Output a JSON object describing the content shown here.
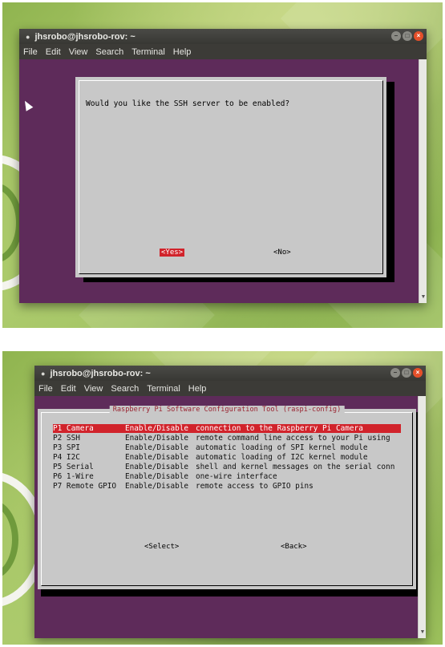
{
  "top": {
    "window_title": "jhsrobo@jhsrobo-rov: ~",
    "menu": [
      "File",
      "Edit",
      "View",
      "Search",
      "Terminal",
      "Help"
    ],
    "dialog": {
      "question": "Would you like the SSH server to be enabled?",
      "yes_label": "<Yes>",
      "no_label": "<No>",
      "selected": "yes"
    }
  },
  "bottom": {
    "window_title": "jhsrobo@jhsrobo-rov: ~",
    "menu": [
      "File",
      "Edit",
      "View",
      "Search",
      "Terminal",
      "Help"
    ],
    "tool_title": "Raspberry Pi Software Configuration Tool (raspi-config)",
    "items": [
      {
        "id": "P1 Camera",
        "action": "Enable/Disable",
        "desc": "connection to the Raspberry Pi Camera"
      },
      {
        "id": "P2 SSH",
        "action": "Enable/Disable",
        "desc": "remote command line access to your Pi using"
      },
      {
        "id": "P3 SPI",
        "action": "Enable/Disable",
        "desc": "automatic loading of SPI kernel module"
      },
      {
        "id": "P4 I2C",
        "action": "Enable/Disable",
        "desc": "automatic loading of I2C kernel module"
      },
      {
        "id": "P5 Serial",
        "action": "Enable/Disable",
        "desc": "shell and kernel messages on the serial conn"
      },
      {
        "id": "P6 1-Wire",
        "action": "Enable/Disable",
        "desc": "one-wire interface"
      },
      {
        "id": "P7 Remote GPIO",
        "action": "Enable/Disable",
        "desc": "remote access to GPIO pins"
      }
    ],
    "selected_index": 0,
    "select_label": "<Select>",
    "back_label": "<Back>"
  },
  "colors": {
    "terminal_bg": "#5e2b5a",
    "dialog_bg": "#c8c8c8",
    "highlight": "#d1232b",
    "title_text": "#9a2330"
  },
  "icons": {
    "window_close": "close-icon",
    "window_minimize": "minimize-icon",
    "window_maximize": "maximize-icon",
    "pointer": "mouse-cursor-icon"
  }
}
